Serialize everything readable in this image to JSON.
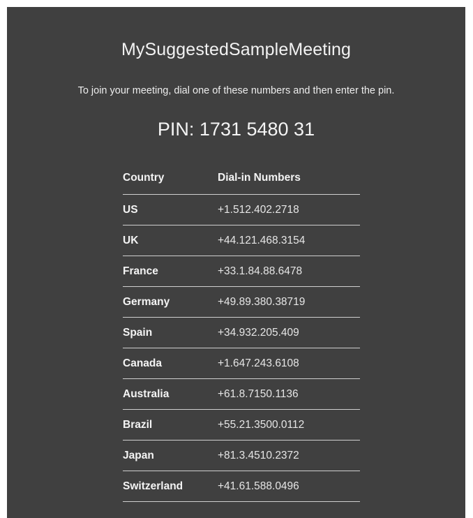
{
  "meeting": {
    "title": "MySuggestedSampleMeeting",
    "instructions": "To join your meeting, dial one of these numbers and then enter the pin.",
    "pin_text": "PIN: 1731 5480 31"
  },
  "table": {
    "headers": {
      "country": "Country",
      "number": "Dial-in Numbers"
    },
    "rows": [
      {
        "country": "US",
        "number": "+1.512.402.2718"
      },
      {
        "country": "UK",
        "number": "+44.121.468.3154"
      },
      {
        "country": "France",
        "number": "+33.1.84.88.6478"
      },
      {
        "country": "Germany",
        "number": "+49.89.380.38719"
      },
      {
        "country": "Spain",
        "number": "+34.932.205.409"
      },
      {
        "country": "Canada",
        "number": "+1.647.243.6108"
      },
      {
        "country": "Australia",
        "number": "+61.8.7150.1136"
      },
      {
        "country": "Brazil",
        "number": "+55.21.3500.0112"
      },
      {
        "country": "Japan",
        "number": "+81.3.4510.2372"
      },
      {
        "country": "Switzerland",
        "number": "+41.61.588.0496"
      }
    ]
  }
}
